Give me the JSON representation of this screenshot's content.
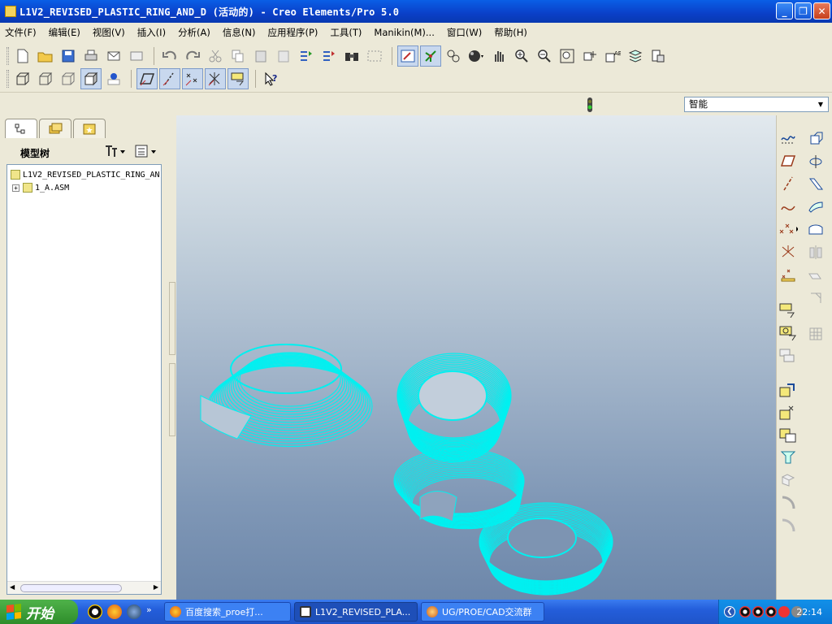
{
  "window": {
    "title": "L1V2_REVISED_PLASTIC_RING_AND_D (活动的) - Creo Elements/Pro 5.0",
    "minimize": "_",
    "restore": "❐",
    "close": "✕"
  },
  "menu": [
    "文件(F)",
    "编辑(E)",
    "视图(V)",
    "插入(I)",
    "分析(A)",
    "信息(N)",
    "应用程序(P)",
    "工具(T)",
    "Manikin(M)...",
    "窗口(W)",
    "帮助(H)"
  ],
  "selection_filter": {
    "value": "智能"
  },
  "model_tree": {
    "title": "模型树",
    "items": [
      {
        "label": "L1V2_REVISED_PLASTIC_RING_AN",
        "expander": ""
      },
      {
        "label": "1_A.ASM",
        "expander": "+"
      }
    ]
  },
  "model_color": "#00f0f0",
  "taskbar": {
    "start_label": "开始",
    "tasks": [
      {
        "label": "百度搜索_proe打..."
      },
      {
        "label": "L1V2_REVISED_PLA..."
      },
      {
        "label": "UG/PROE/CAD交流群"
      }
    ],
    "clock": "22:14",
    "expand_arrow": "»"
  }
}
